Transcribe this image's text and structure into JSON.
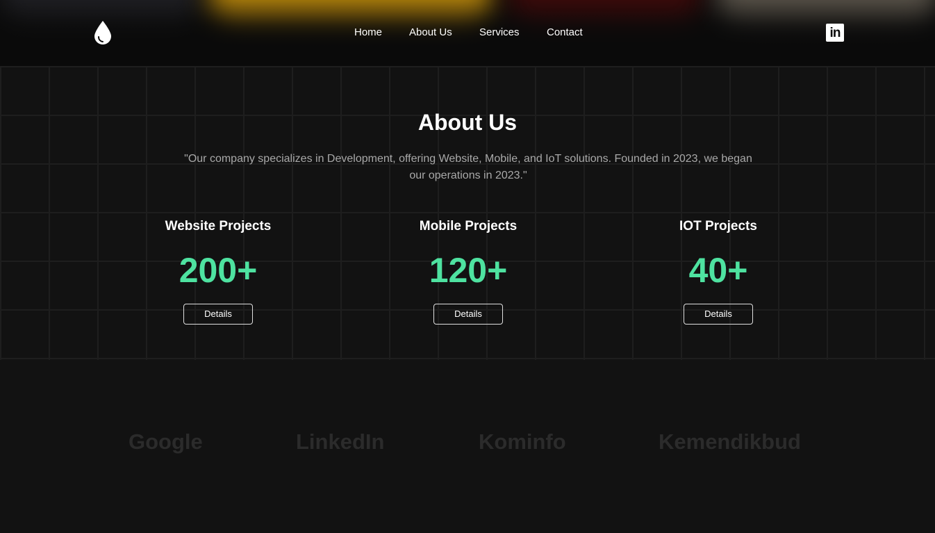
{
  "header": {
    "logo_icon": "water-drop-icon",
    "nav": [
      {
        "label": "Home"
      },
      {
        "label": "About Us"
      },
      {
        "label": "Services"
      },
      {
        "label": "Contact"
      }
    ],
    "social_icon": "linkedin-icon",
    "social_text": "in"
  },
  "about": {
    "title": "About Us",
    "description": "\"Our company specializes in Development, offering Website, Mobile, and IoT solutions. Founded in 2023, we began our operations in 2023.\"",
    "stats": [
      {
        "label": "Website Projects",
        "value": "200+",
        "button": "Details"
      },
      {
        "label": "Mobile Projects",
        "value": "120+",
        "button": "Details"
      },
      {
        "label": "IOT Projects",
        "value": "40+",
        "button": "Details"
      }
    ]
  },
  "partners": [
    "Google",
    "LinkedIn",
    "Kominfo",
    "Kemendikbud"
  ],
  "colors": {
    "background": "#121212",
    "accent": "#4ee2a0",
    "text": "#ffffff",
    "muted": "#a9a9a9",
    "partner": "#2b2b2b"
  }
}
